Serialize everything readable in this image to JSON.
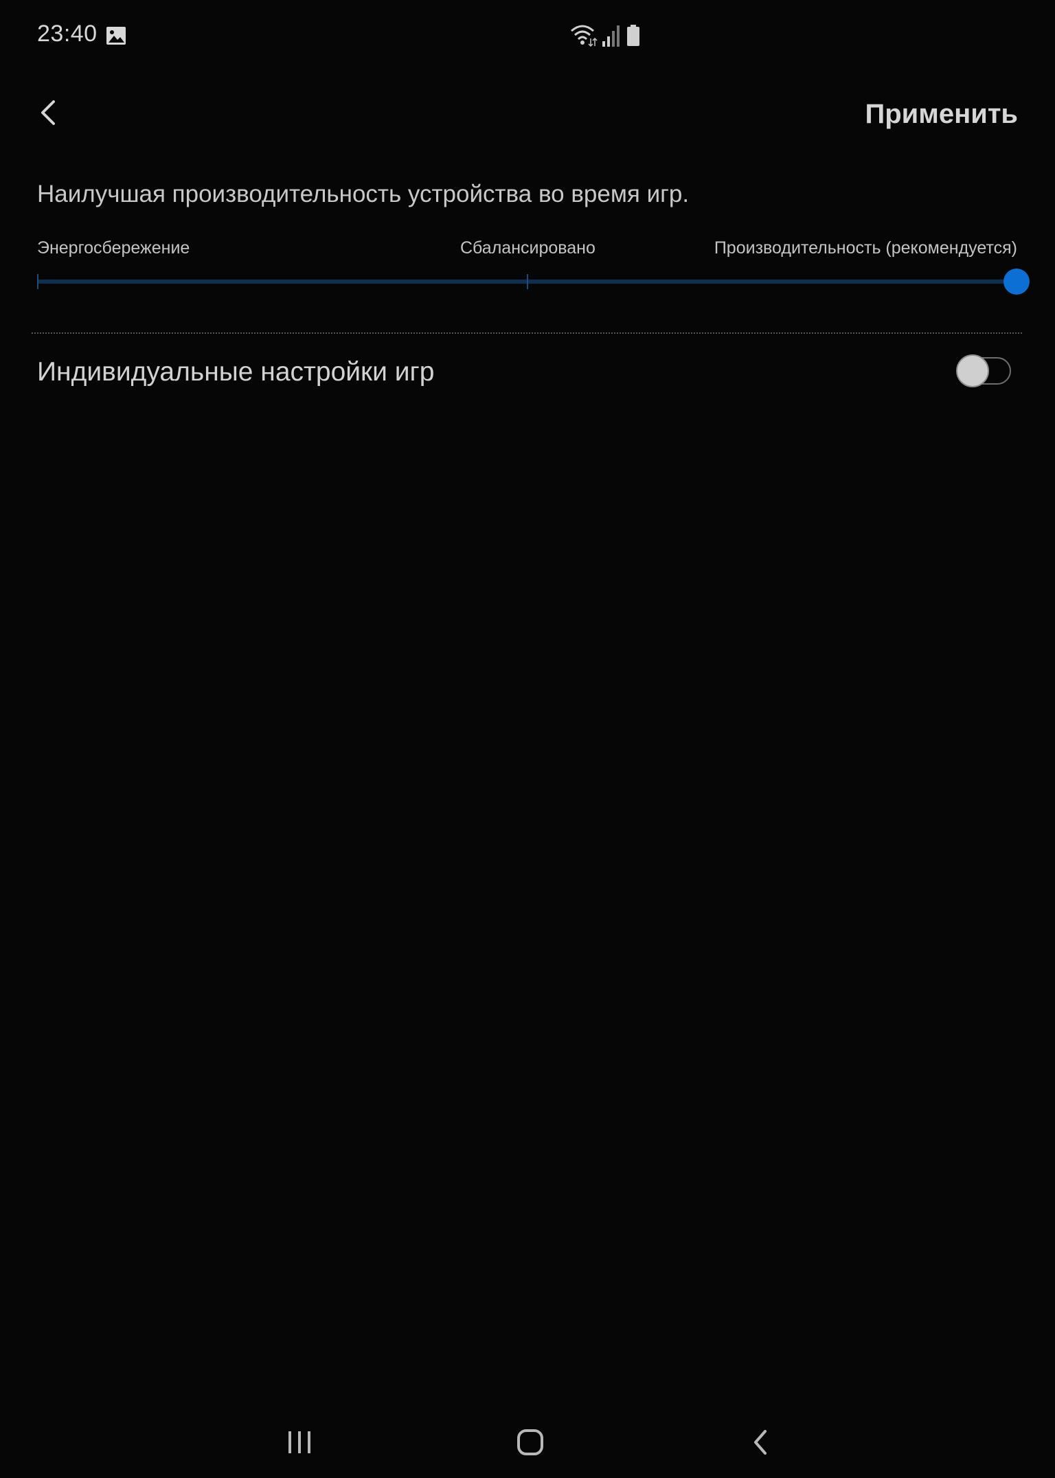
{
  "status_bar": {
    "time": "23:40",
    "icons": [
      "gallery-icon",
      "wifi-icon",
      "signal-icon",
      "battery-icon"
    ]
  },
  "header": {
    "back_icon": "back-arrow-icon",
    "apply_label": "Применить"
  },
  "performance": {
    "description": "Наилучшая производительность устройства во время игр.",
    "levels": [
      "Энергосбережение",
      "Сбалансировано",
      "Производительность (рекомендуется)"
    ],
    "selected_index": 2
  },
  "individual_settings": {
    "label": "Индивидуальные настройки игр",
    "enabled": false
  },
  "nav_bar": {
    "buttons": [
      "recents-icon",
      "home-icon",
      "back-icon"
    ]
  },
  "colors": {
    "background": "#060606",
    "accent": "#0b6fd4",
    "track": "#0d2f50",
    "text": "#d2d2d2"
  }
}
